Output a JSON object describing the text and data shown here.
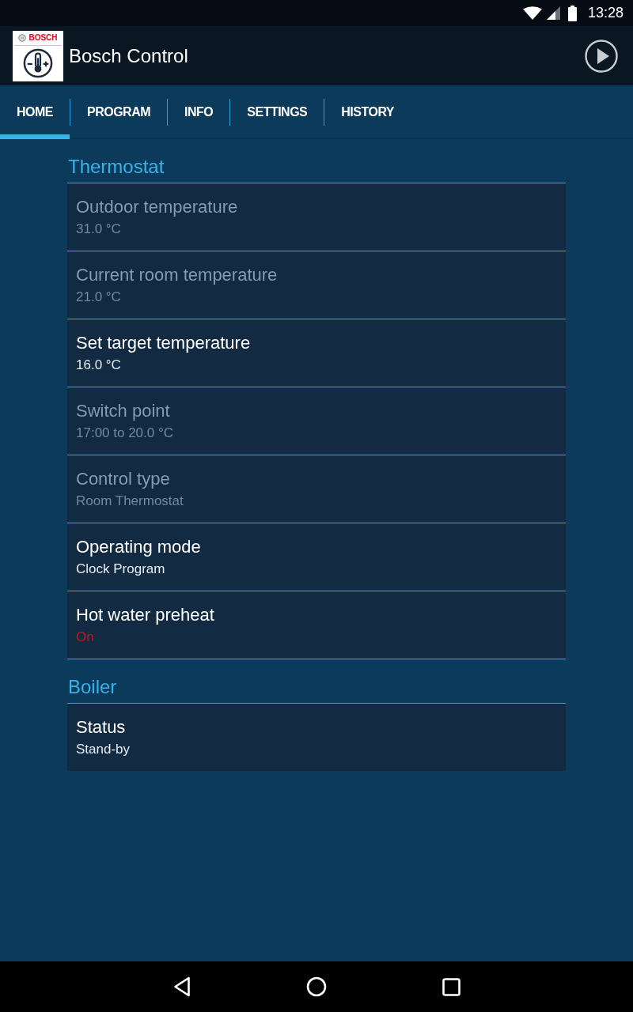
{
  "status_bar": {
    "time": "13:28"
  },
  "app_bar": {
    "logo_text": "BOSCH",
    "title": "Bosch Control"
  },
  "tabs": [
    {
      "label": "HOME",
      "selected": true
    },
    {
      "label": "PROGRAM",
      "selected": false
    },
    {
      "label": "INFO",
      "selected": false
    },
    {
      "label": "SETTINGS",
      "selected": false
    },
    {
      "label": "HISTORY",
      "selected": false
    }
  ],
  "sections": [
    {
      "title": "Thermostat",
      "items": [
        {
          "label": "Outdoor temperature",
          "value": "31.0 °C",
          "disabled": true
        },
        {
          "label": "Current room temperature",
          "value": "21.0 °C",
          "disabled": true
        },
        {
          "label": "Set target temperature",
          "value": "16.0 °C",
          "disabled": false
        },
        {
          "label": "Switch point",
          "value": "17:00 to 20.0 °C",
          "disabled": true
        },
        {
          "label": "Control type",
          "value": "Room Thermostat",
          "disabled": true
        },
        {
          "label": "Operating mode",
          "value": "Clock Program",
          "disabled": false
        },
        {
          "label": "Hot water preheat",
          "value": "On",
          "disabled": false,
          "color": "#cc1122"
        }
      ]
    },
    {
      "title": "Boiler",
      "items": [
        {
          "label": "Status",
          "value": "Stand-by",
          "disabled": false
        }
      ]
    }
  ]
}
